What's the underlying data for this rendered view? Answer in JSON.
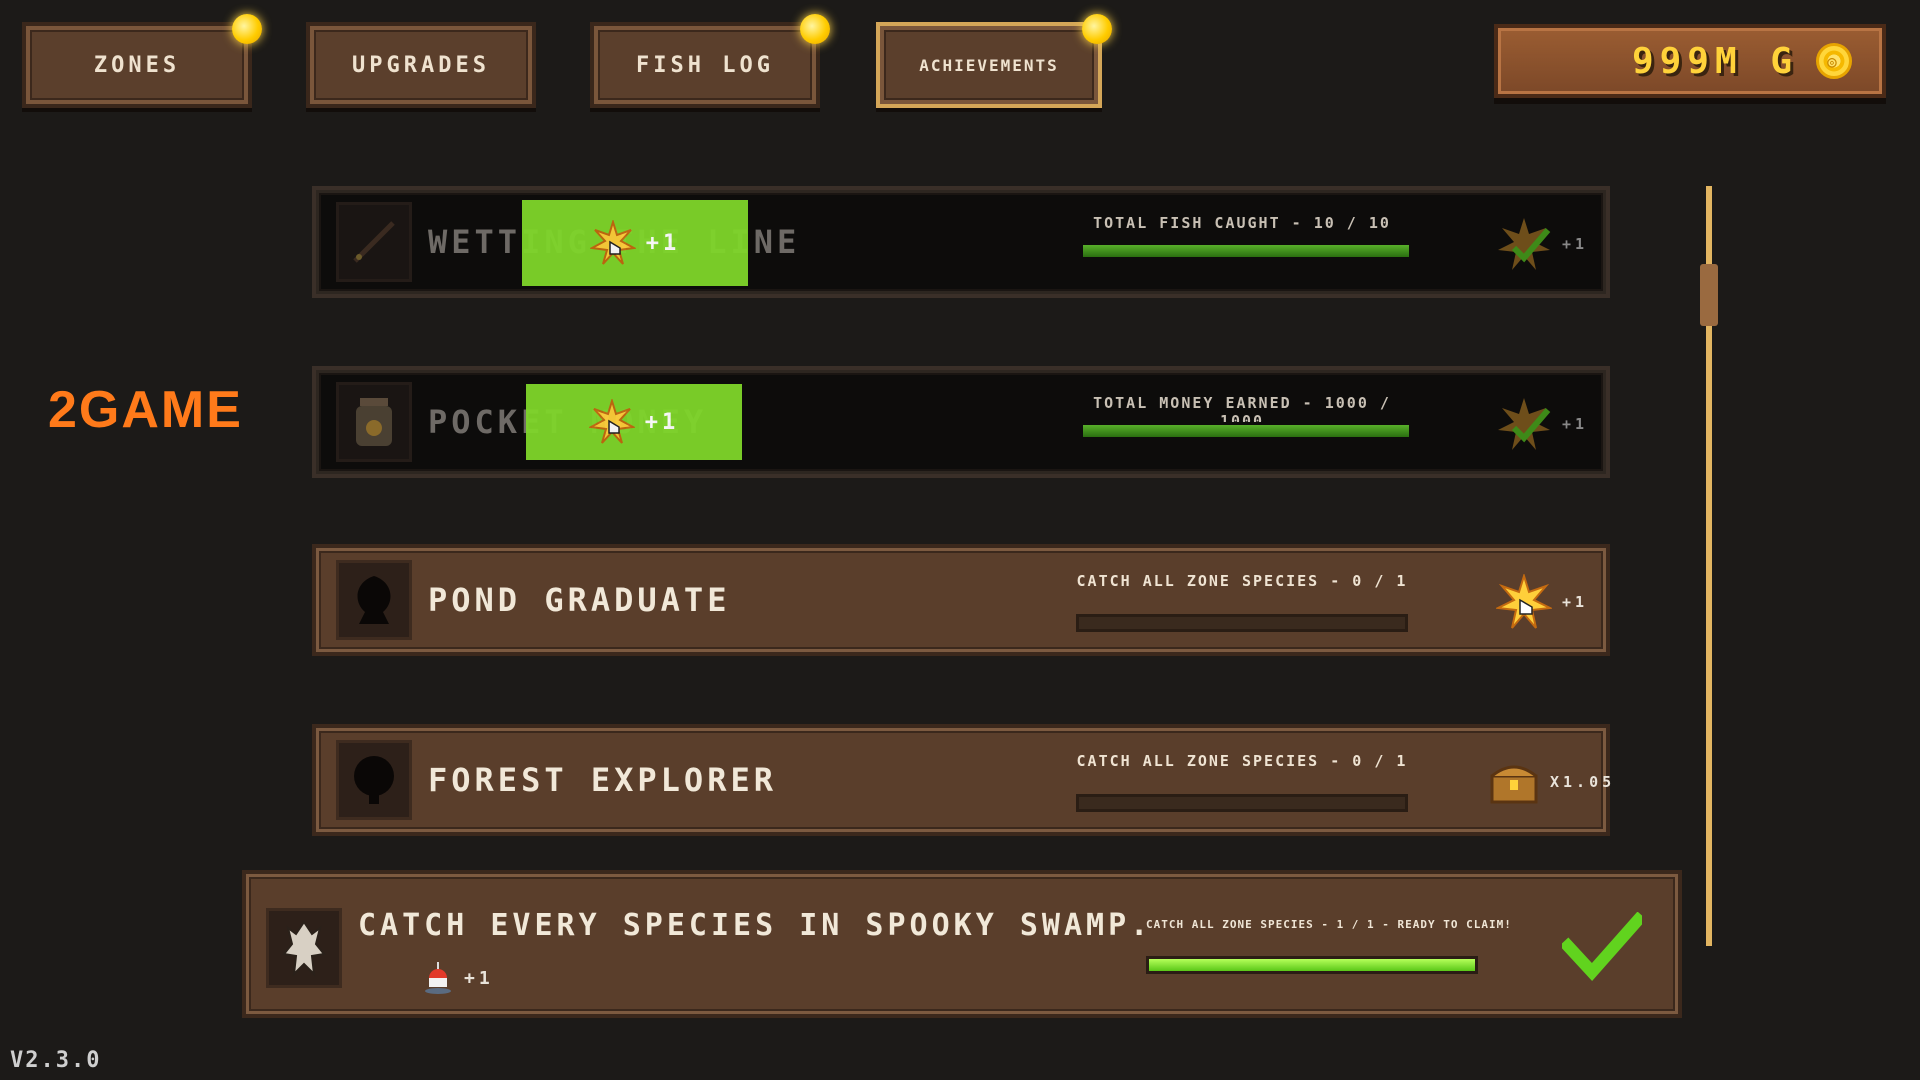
{
  "nav": {
    "zones": "ZONES",
    "upgrades": "UPGRADES",
    "fish_log": "FISH LOG",
    "achievements": "ACHIEVEMENTS"
  },
  "money": {
    "amount": "999M G",
    "coin_glyph": "◎"
  },
  "logo": "2GAME",
  "version": "V2.3.0",
  "achievements": [
    {
      "title": "WETTING THE LINE",
      "requirement": "TOTAL FISH CAUGHT - 10 / 10",
      "progress": 1.0,
      "reward": "+1",
      "overlay": "+1",
      "status": "claimed"
    },
    {
      "title": "POCKET MONEY",
      "requirement": "TOTAL MONEY EARNED - 1000 / 1000",
      "progress": 1.0,
      "reward": "+1",
      "overlay": "+1",
      "status": "claimed"
    },
    {
      "title": "POND GRADUATE",
      "requirement": "CATCH ALL ZONE SPECIES - 0 / 1",
      "progress": 0.0,
      "reward": "+1",
      "status": "locked"
    },
    {
      "title": "FOREST EXPLORER",
      "requirement": "CATCH ALL ZONE SPECIES - 0 / 1",
      "progress": 0.0,
      "reward": "X1.05",
      "status": "locked"
    },
    {
      "title": "CATCH EVERY SPECIES IN SPOOKY SWAMP.",
      "requirement": "CATCH ALL ZONE SPECIES - 1 / 1 - READY TO CLAIM!",
      "progress": 1.0,
      "reward": "+1",
      "status": "ready"
    }
  ],
  "colors": {
    "accent_green": "#7fd62a",
    "gold": "#ffd23a",
    "brown": "#5a3e2b"
  }
}
